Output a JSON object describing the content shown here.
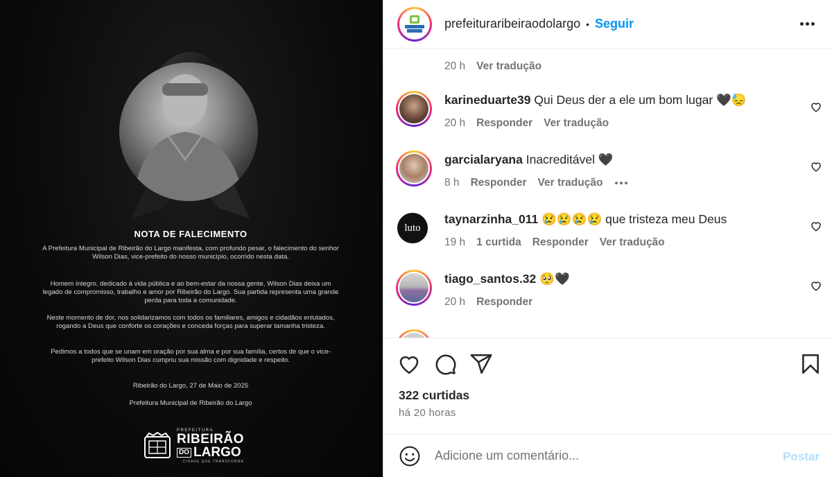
{
  "post_image": {
    "title": "NOTA DE FALECIMENTO",
    "paragraph1": "A Prefeitura Municipal de Ribeirão do Largo manifesta, com profundo pesar, o falecimento do senhor Wilson Dias, vice-prefeito do nosso município, ocorrido nesta data.",
    "paragraph2": "Homem íntegro, dedicado à vida pública e ao bem-estar da nossa gente, Wilson Dias deixa um legado de compromisso, trabalho e amor por Ribeirão do Largo. Sua partida representa uma grande perda para toda a comunidade.",
    "paragraph3": "Neste momento de dor, nos solidarizamos com todos os familiares, amigos e cidadãos enlutados, rogando a Deus que conforte os corações e conceda forças para superar tamanha tristeza.",
    "paragraph4": "Pedimos a todos que se unam em oração por sua alma e por sua família, certos de que o vice-prefeito Wilson Dias cumpriu sua missão com dignidade e respeito.",
    "place_date": "Ribeirão do Largo, 27 de Maio de 2025",
    "signature": "Prefeitura Municipal de Ribeirão do Largo",
    "logo": {
      "small": "PREFEITURA",
      "line1": "RIBEIRÃO",
      "do": "DO",
      "line2": "LARGO",
      "slogan": "CIDADE QUE TRANSFORMA"
    }
  },
  "header": {
    "username": "prefeituraribeiraodolargo",
    "dot": "•",
    "follow_label": "Seguir",
    "avatar_text": "RIBEIRÃO DO LARGO"
  },
  "comments": [
    {
      "username": "",
      "text": "",
      "time": "20 h",
      "likes": "",
      "actions": [
        "Ver tradução"
      ]
    },
    {
      "username": "karineduarte39",
      "text": "Qui Deus der a ele um bom lugar 🖤😓",
      "time": "20 h",
      "actions": [
        "Responder",
        "Ver tradução"
      ]
    },
    {
      "username": "garcialaryana",
      "text": "Inacreditável 🖤",
      "time": "8 h",
      "actions": [
        "Responder",
        "Ver tradução"
      ]
    },
    {
      "username": "taynarzinha_011",
      "text": "😢😢😢😢 que tristeza meu Deus",
      "time": "19 h",
      "likes": "1 curtida",
      "actions": [
        "Responder",
        "Ver tradução"
      ],
      "avatar_text": "luto"
    },
    {
      "username": "tiago_santos.32",
      "text": "🥺🖤",
      "time": "20 h",
      "actions": [
        "Responder"
      ]
    }
  ],
  "likes_count": "322 curtidas",
  "posted_ago": "há 20 horas",
  "add_comment": {
    "placeholder": "Adicione um comentário...",
    "post_label": "Postar"
  }
}
